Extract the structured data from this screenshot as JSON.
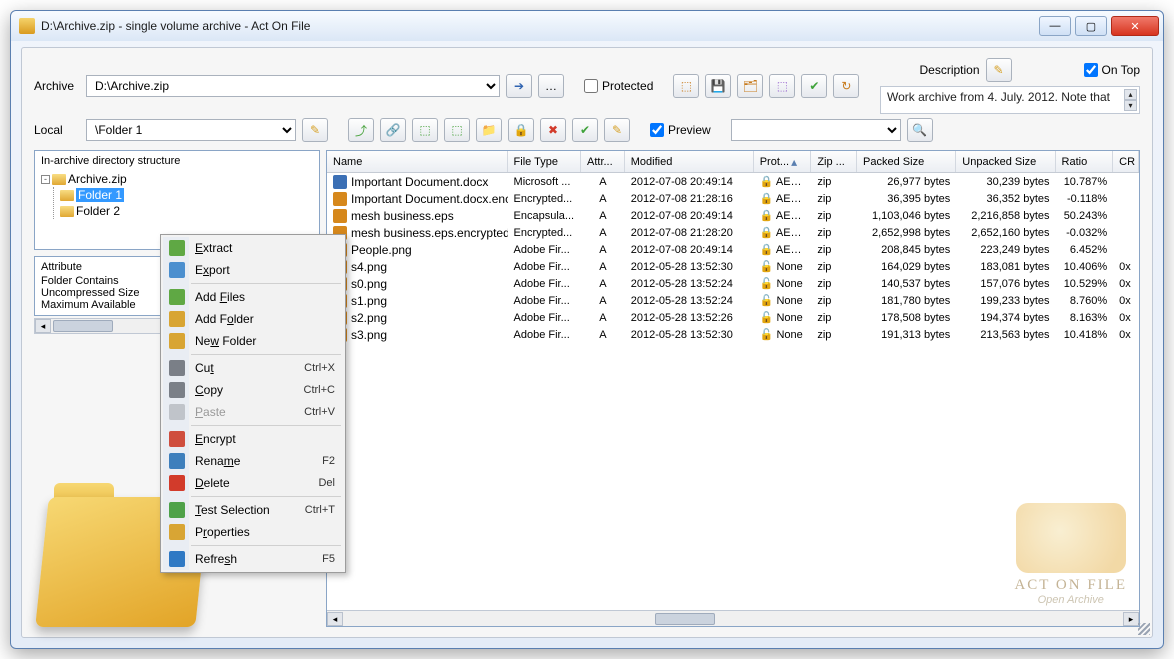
{
  "window": {
    "title": "D:\\Archive.zip - single volume archive - Act On File"
  },
  "labels": {
    "archive": "Archive",
    "local": "Local",
    "protected": "Protected",
    "preview": "Preview",
    "description": "Description",
    "ontop": "On Top"
  },
  "archive_combo": "D:\\Archive.zip",
  "local_combo": "\\Folder 1",
  "preview_combo": "",
  "desc_text": "Work archive from 4. July. 2012. Note that",
  "tree": {
    "header": "In-archive directory structure",
    "root": "Archive.zip",
    "children": [
      "Folder 1",
      "Folder 2"
    ],
    "selected": "Folder 1"
  },
  "attributes": {
    "header": "Attribute",
    "lines": [
      "Folder Contains",
      "Uncompressed Size",
      "Maximum Available"
    ]
  },
  "columns": [
    "Name",
    "File Type",
    "Attr...",
    "Modified",
    "Prot...",
    "Zip ...",
    "Packed Size",
    "Unpacked Size",
    "Ratio",
    "CR"
  ],
  "sort_column": "Prot...",
  "files": [
    {
      "name": "Important Document.docx",
      "type": "Microsoft ...",
      "attr": "A",
      "mod": "2012-07-08 20:49:14",
      "lock": "locked",
      "prot": "AES ...",
      "zip": "zip",
      "packed": "26,977 bytes",
      "unpacked": "30,239 bytes",
      "ratio": "10.787%",
      "crc": "",
      "ic": "#3b6fb5"
    },
    {
      "name": "Important Document.docx.encry...",
      "type": "Encrypted...",
      "attr": "A",
      "mod": "2012-07-08 21:28:16",
      "lock": "locked",
      "prot": "AES ...",
      "zip": "zip",
      "packed": "36,395 bytes",
      "unpacked": "36,352 bytes",
      "ratio": "-0.118%",
      "crc": "",
      "ic": "#d6881c"
    },
    {
      "name": "mesh business.eps",
      "type": "Encapsula...",
      "attr": "A",
      "mod": "2012-07-08 20:49:14",
      "lock": "locked",
      "prot": "AES ...",
      "zip": "zip",
      "packed": "1,103,046 bytes",
      "unpacked": "2,216,858 bytes",
      "ratio": "50.243%",
      "crc": "",
      "ic": "#d6881c"
    },
    {
      "name": "mesh business.eps.encrypted",
      "type": "Encrypted...",
      "attr": "A",
      "mod": "2012-07-08 21:28:20",
      "lock": "locked",
      "prot": "AES ...",
      "zip": "zip",
      "packed": "2,652,998 bytes",
      "unpacked": "2,652,160 bytes",
      "ratio": "-0.032%",
      "crc": "",
      "ic": "#d6881c"
    },
    {
      "name": "People.png",
      "type": "Adobe Fir...",
      "attr": "A",
      "mod": "2012-07-08 20:49:14",
      "lock": "locked",
      "prot": "AES ...",
      "zip": "zip",
      "packed": "208,845 bytes",
      "unpacked": "223,249 bytes",
      "ratio": "6.452%",
      "crc": "",
      "ic": "#d6881c"
    },
    {
      "name": "s4.png",
      "type": "Adobe Fir...",
      "attr": "A",
      "mod": "2012-05-28 13:52:30",
      "lock": "open",
      "prot": "None",
      "zip": "zip",
      "packed": "164,029 bytes",
      "unpacked": "183,081 bytes",
      "ratio": "10.406%",
      "crc": "0x",
      "ic": "#d6881c"
    },
    {
      "name": "s0.png",
      "type": "Adobe Fir...",
      "attr": "A",
      "mod": "2012-05-28 13:52:24",
      "lock": "open",
      "prot": "None",
      "zip": "zip",
      "packed": "140,537 bytes",
      "unpacked": "157,076 bytes",
      "ratio": "10.529%",
      "crc": "0x",
      "ic": "#d6881c"
    },
    {
      "name": "s1.png",
      "type": "Adobe Fir...",
      "attr": "A",
      "mod": "2012-05-28 13:52:24",
      "lock": "open",
      "prot": "None",
      "zip": "zip",
      "packed": "181,780 bytes",
      "unpacked": "199,233 bytes",
      "ratio": "8.760%",
      "crc": "0x",
      "ic": "#d6881c"
    },
    {
      "name": "s2.png",
      "type": "Adobe Fir...",
      "attr": "A",
      "mod": "2012-05-28 13:52:26",
      "lock": "open",
      "prot": "None",
      "zip": "zip",
      "packed": "178,508 bytes",
      "unpacked": "194,374 bytes",
      "ratio": "8.163%",
      "crc": "0x",
      "ic": "#d6881c"
    },
    {
      "name": "s3.png",
      "type": "Adobe Fir...",
      "attr": "A",
      "mod": "2012-05-28 13:52:30",
      "lock": "open",
      "prot": "None",
      "zip": "zip",
      "packed": "191,313 bytes",
      "unpacked": "213,563 bytes",
      "ratio": "10.418%",
      "crc": "0x",
      "ic": "#d6881c"
    }
  ],
  "context_menu": [
    {
      "label": "Extract",
      "short": "",
      "dis": false,
      "sep": false,
      "u": 0,
      "ic": "#5fa844"
    },
    {
      "label": "Export",
      "short": "",
      "dis": false,
      "sep": true,
      "u": 1,
      "ic": "#4b8fcf"
    },
    {
      "label": "Add Files",
      "short": "",
      "dis": false,
      "sep": false,
      "u": 4,
      "ic": "#5fa844"
    },
    {
      "label": "Add Folder",
      "short": "",
      "dis": false,
      "sep": false,
      "u": 5,
      "ic": "#d8a534"
    },
    {
      "label": "New Folder",
      "short": "",
      "dis": false,
      "sep": true,
      "u": 2,
      "ic": "#d8a534"
    },
    {
      "label": "Cut",
      "short": "Ctrl+X",
      "dis": false,
      "sep": false,
      "u": 2,
      "ic": "#7a7f87"
    },
    {
      "label": "Copy",
      "short": "Ctrl+C",
      "dis": false,
      "sep": false,
      "u": 0,
      "ic": "#7a7f87"
    },
    {
      "label": "Paste",
      "short": "Ctrl+V",
      "dis": true,
      "sep": true,
      "u": 0,
      "ic": "#c0c4ca"
    },
    {
      "label": "Encrypt",
      "short": "",
      "dis": false,
      "sep": false,
      "u": 0,
      "ic": "#cf4e3e"
    },
    {
      "label": "Rename",
      "short": "F2",
      "dis": false,
      "sep": false,
      "u": 4,
      "ic": "#3e7fbc"
    },
    {
      "label": "Delete",
      "short": "Del",
      "dis": false,
      "sep": true,
      "u": 0,
      "ic": "#d23b2b"
    },
    {
      "label": "Test Selection",
      "short": "Ctrl+T",
      "dis": false,
      "sep": false,
      "u": 0,
      "ic": "#4ea24a"
    },
    {
      "label": "Properties",
      "short": "",
      "dis": false,
      "sep": true,
      "u": 1,
      "ic": "#d8a534"
    },
    {
      "label": "Refresh",
      "short": "F5",
      "dis": false,
      "sep": false,
      "u": 5,
      "ic": "#2f79c4"
    }
  ],
  "watermark": {
    "line1": "ACT ON FILE",
    "line2": "Open Archive"
  }
}
